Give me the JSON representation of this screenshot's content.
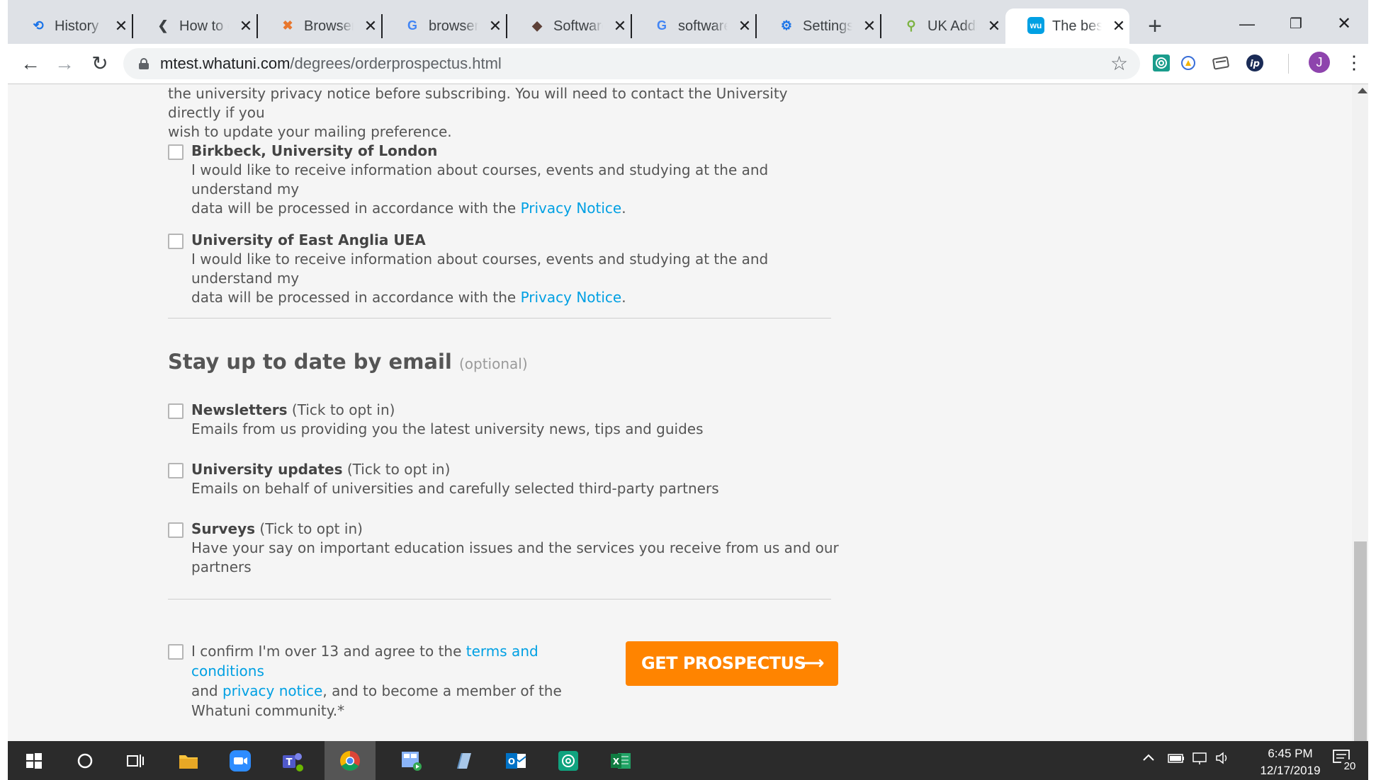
{
  "browser": {
    "tabs": [
      {
        "title": "History",
        "icon": "history-icon",
        "icon_glyph": "⟲",
        "icon_color": "#1a73e8"
      },
      {
        "title": "How to cl",
        "icon": "bracket-icon",
        "icon_glyph": "❮",
        "icon_color": "#3c4043"
      },
      {
        "title": "BrowserW",
        "icon": "browserw-icon",
        "icon_glyph": "✖",
        "icon_color": "#e8772e"
      },
      {
        "title": "browser s",
        "icon": "google-icon",
        "icon_glyph": "G",
        "icon_color": "#4285f4"
      },
      {
        "title": "Software",
        "icon": "software-icon",
        "icon_glyph": "◆",
        "icon_color": "#5d4037"
      },
      {
        "title": "software t",
        "icon": "google-icon",
        "icon_glyph": "G",
        "icon_color": "#4285f4"
      },
      {
        "title": "Settings",
        "icon": "gear-icon",
        "icon_glyph": "⚙",
        "icon_color": "#1a73e8"
      },
      {
        "title": "UK Addre",
        "icon": "map-pin-icon",
        "icon_glyph": "⚲",
        "icon_color": "#7cb342"
      },
      {
        "title": "The best",
        "icon": "whatuni-icon",
        "icon_glyph": "wu",
        "icon_color": "#00a0e3",
        "active": true
      }
    ],
    "close_glyph": "✕",
    "new_tab_glyph": "+",
    "window_controls": {
      "minimize": "—",
      "restore": "❐",
      "close": "✕"
    },
    "url_host": "mtest.whatuni.com",
    "url_path": "/degrees/orderprospectus.html",
    "nav": {
      "back": "←",
      "forward": "→",
      "reload": "↻"
    },
    "star_glyph": "☆",
    "avatar_letter": "J",
    "menu_glyph": "⋮"
  },
  "page": {
    "intro_line1": "the university privacy notice before subscribing. You will need to contact the University directly if you",
    "intro_line2": "wish to update your mailing preference.",
    "universities": [
      {
        "name": "Birkbeck, University of London",
        "text_line1": "I would like to receive information about courses, events and studying at the and understand my",
        "text_line2_prefix": "data will be processed in accordance with the ",
        "link": "Privacy Notice",
        "suffix": "."
      },
      {
        "name": "University of East Anglia UEA",
        "text_line1": "I would like to receive information about courses, events and studying at the and understand my",
        "text_line2_prefix": "data will be processed in accordance with the ",
        "link": "Privacy Notice",
        "suffix": "."
      }
    ],
    "email_section": {
      "title": "Stay up to date by email",
      "optional": "(optional)",
      "options": [
        {
          "label": "Newsletters",
          "note": " (Tick to opt in)",
          "desc": "Emails from us providing you the latest university news, tips and guides"
        },
        {
          "label": "University updates",
          "note": " (Tick to opt in)",
          "desc": "Emails on behalf of universities and carefully selected third-party partners"
        },
        {
          "label": "Surveys",
          "note": " (Tick to opt in)",
          "desc": "Have your say on important education issues and the services you receive from us and our partners"
        }
      ]
    },
    "confirm": {
      "prefix": "I confirm I'm over 13 and agree to the ",
      "terms_link": "terms and conditions",
      "and": "and ",
      "privacy_link": "privacy notice",
      "middle": ", and to become a member of the",
      "last": "Whatuni community.*"
    },
    "cta_label": "GET PROSPECTUS",
    "cta_arrow": "⟶"
  },
  "taskbar": {
    "time": "6:45 PM",
    "date": "12/17/2019",
    "notification_count": "20"
  },
  "colors": {
    "accent_orange": "#ff8400",
    "link_blue": "#00a0e3",
    "page_bg": "#f5f5f5"
  }
}
